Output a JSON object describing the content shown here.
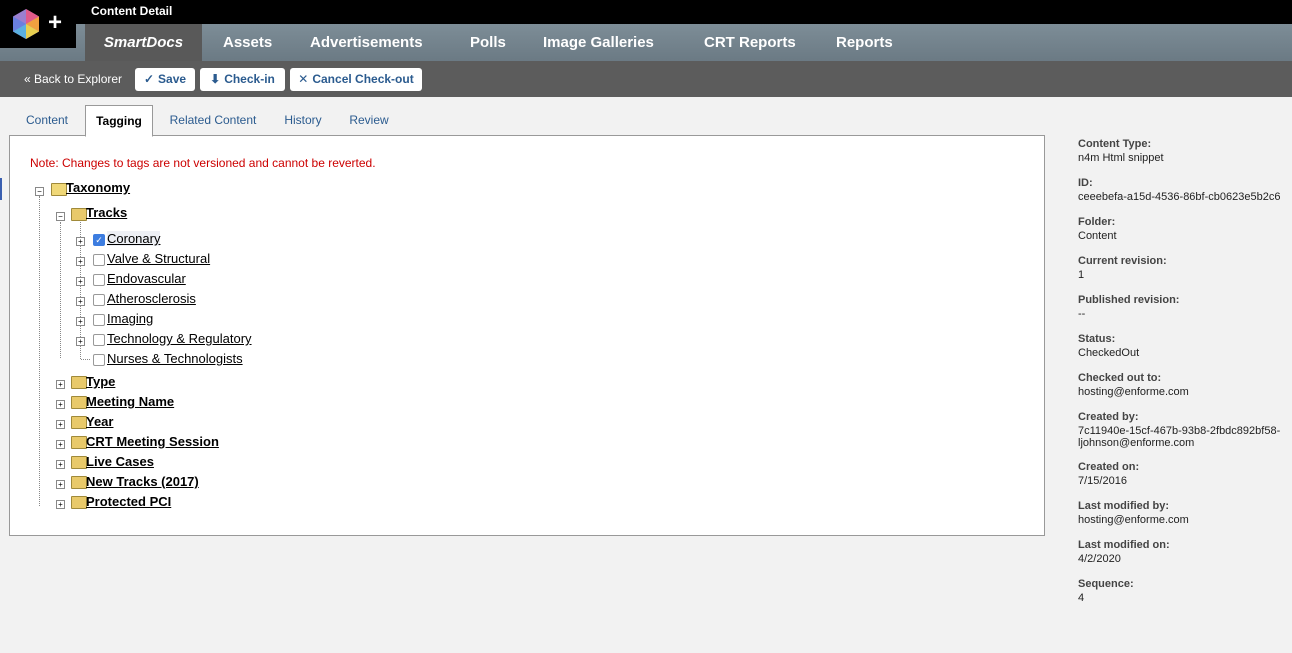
{
  "window": {
    "title": "Content Detail"
  },
  "nav": [
    {
      "label": "SmartDocs",
      "active": true
    },
    {
      "label": "Assets"
    },
    {
      "label": "Advertisements"
    },
    {
      "label": "Polls"
    },
    {
      "label": "Image Galleries"
    },
    {
      "label": "CRT Reports"
    },
    {
      "label": "Reports"
    }
  ],
  "toolbar": {
    "back": "« Back to Explorer",
    "save": "Save",
    "checkin": "Check-in",
    "cancel": "Cancel Check-out"
  },
  "tabs": [
    "Content",
    "Tagging",
    "Related Content",
    "History",
    "Review"
  ],
  "tagging": {
    "note": "Note: Changes to tags are not versioned and cannot be reverted.",
    "root": "Taxonomy",
    "tracks_label": "Tracks",
    "tracks": [
      {
        "label": "Coronary",
        "checked": true
      },
      {
        "label": "Valve & Structural",
        "checked": false
      },
      {
        "label": "Endovascular",
        "checked": false
      },
      {
        "label": "Atherosclerosis",
        "checked": false
      },
      {
        "label": "Imaging",
        "checked": false
      },
      {
        "label": "Technology & Regulatory",
        "checked": false
      },
      {
        "label": "Nurses & Technologists",
        "checked": false
      }
    ],
    "groups": [
      "Type",
      "Meeting Name",
      "Year",
      "CRT Meeting Session",
      "Live Cases",
      "New Tracks (2017)",
      "Protected PCI"
    ]
  },
  "meta": [
    {
      "label": "Content Type:",
      "value": "n4m Html snippet"
    },
    {
      "label": "ID:",
      "value": "ceeebefa-a15d-4536-86bf-cb0623e5b2c6"
    },
    {
      "label": "Folder:",
      "value": "Content"
    },
    {
      "label": "Current revision:",
      "value": "1"
    },
    {
      "label": "Published revision:",
      "value": "--"
    },
    {
      "label": "Status:",
      "value": "CheckedOut"
    },
    {
      "label": "Checked out to:",
      "value": "hosting@enforme.com"
    },
    {
      "label": "Created by:",
      "value": "7c11940e-15cf-467b-93b8-2fbdc892bf58-",
      "value2": "ljohnson@enforme.com"
    },
    {
      "label": "Created on:",
      "value": "7/15/2016"
    },
    {
      "label": "Last modified by:",
      "value": "hosting@enforme.com"
    },
    {
      "label": "Last modified on:",
      "value": "4/2/2020"
    },
    {
      "label": "Sequence:",
      "value": "4"
    }
  ]
}
